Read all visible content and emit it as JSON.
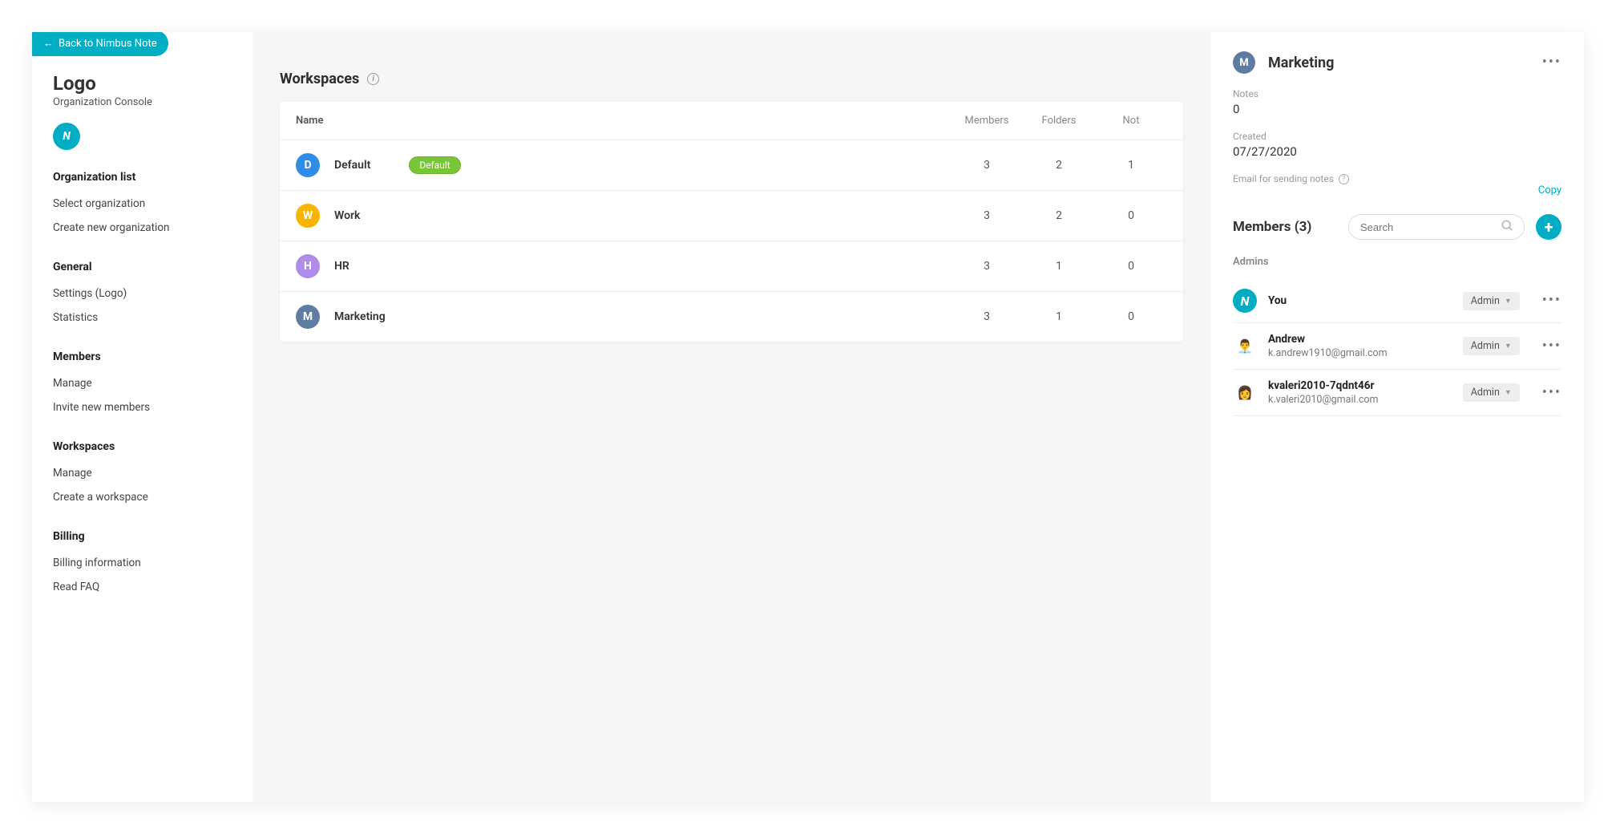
{
  "back_pill": "Back to Nimbus Note",
  "sidebar": {
    "logo_title": "Logo",
    "logo_subtitle": "Organization Console",
    "brand_letter": "N",
    "sections": [
      {
        "title": "Organization list",
        "items": [
          "Select organization",
          "Create new organization"
        ]
      },
      {
        "title": "General",
        "items": [
          "Settings (Logo)",
          "Statistics"
        ]
      },
      {
        "title": "Members",
        "items": [
          "Manage",
          "Invite new members"
        ]
      },
      {
        "title": "Workspaces",
        "items": [
          "Manage",
          "Create a workspace"
        ]
      },
      {
        "title": "Billing",
        "items": [
          "Billing information",
          "Read FAQ"
        ]
      }
    ]
  },
  "main": {
    "heading": "Workspaces",
    "columns": {
      "name": "Name",
      "members": "Members",
      "folders": "Folders",
      "notes": "Not"
    },
    "rows": [
      {
        "letter": "D",
        "color": "#2f8de8",
        "name": "Default",
        "badge": "Default",
        "members": 3,
        "folders": 2,
        "notes": 1
      },
      {
        "letter": "W",
        "color": "#f7b500",
        "name": "Work",
        "members": 3,
        "folders": 2,
        "notes": 0
      },
      {
        "letter": "H",
        "color": "#b08de8",
        "name": "HR",
        "members": 3,
        "folders": 1,
        "notes": 0
      },
      {
        "letter": "M",
        "color": "#5e7da1",
        "name": "Marketing",
        "members": 3,
        "folders": 1,
        "notes": 0
      }
    ]
  },
  "panel": {
    "avatar_letter": "M",
    "title": "Marketing",
    "notes_label": "Notes",
    "notes_value": "0",
    "created_label": "Created",
    "created_value": "07/27/2020",
    "email_label": "Email for sending notes",
    "copy_label": "Copy",
    "members_heading": "Members (3)",
    "search_placeholder": "Search",
    "admins_label": "Admins",
    "members": [
      {
        "avatar": "logo",
        "name": "You",
        "email": "",
        "role": "Admin"
      },
      {
        "avatar": "👨‍💼",
        "name": "Andrew",
        "email": "k.andrew1910@gmail.com",
        "role": "Admin"
      },
      {
        "avatar": "👩",
        "name": "kvaleri2010-7qdnt46r",
        "email": "k.valeri2010@gmail.com",
        "role": "Admin"
      }
    ]
  }
}
